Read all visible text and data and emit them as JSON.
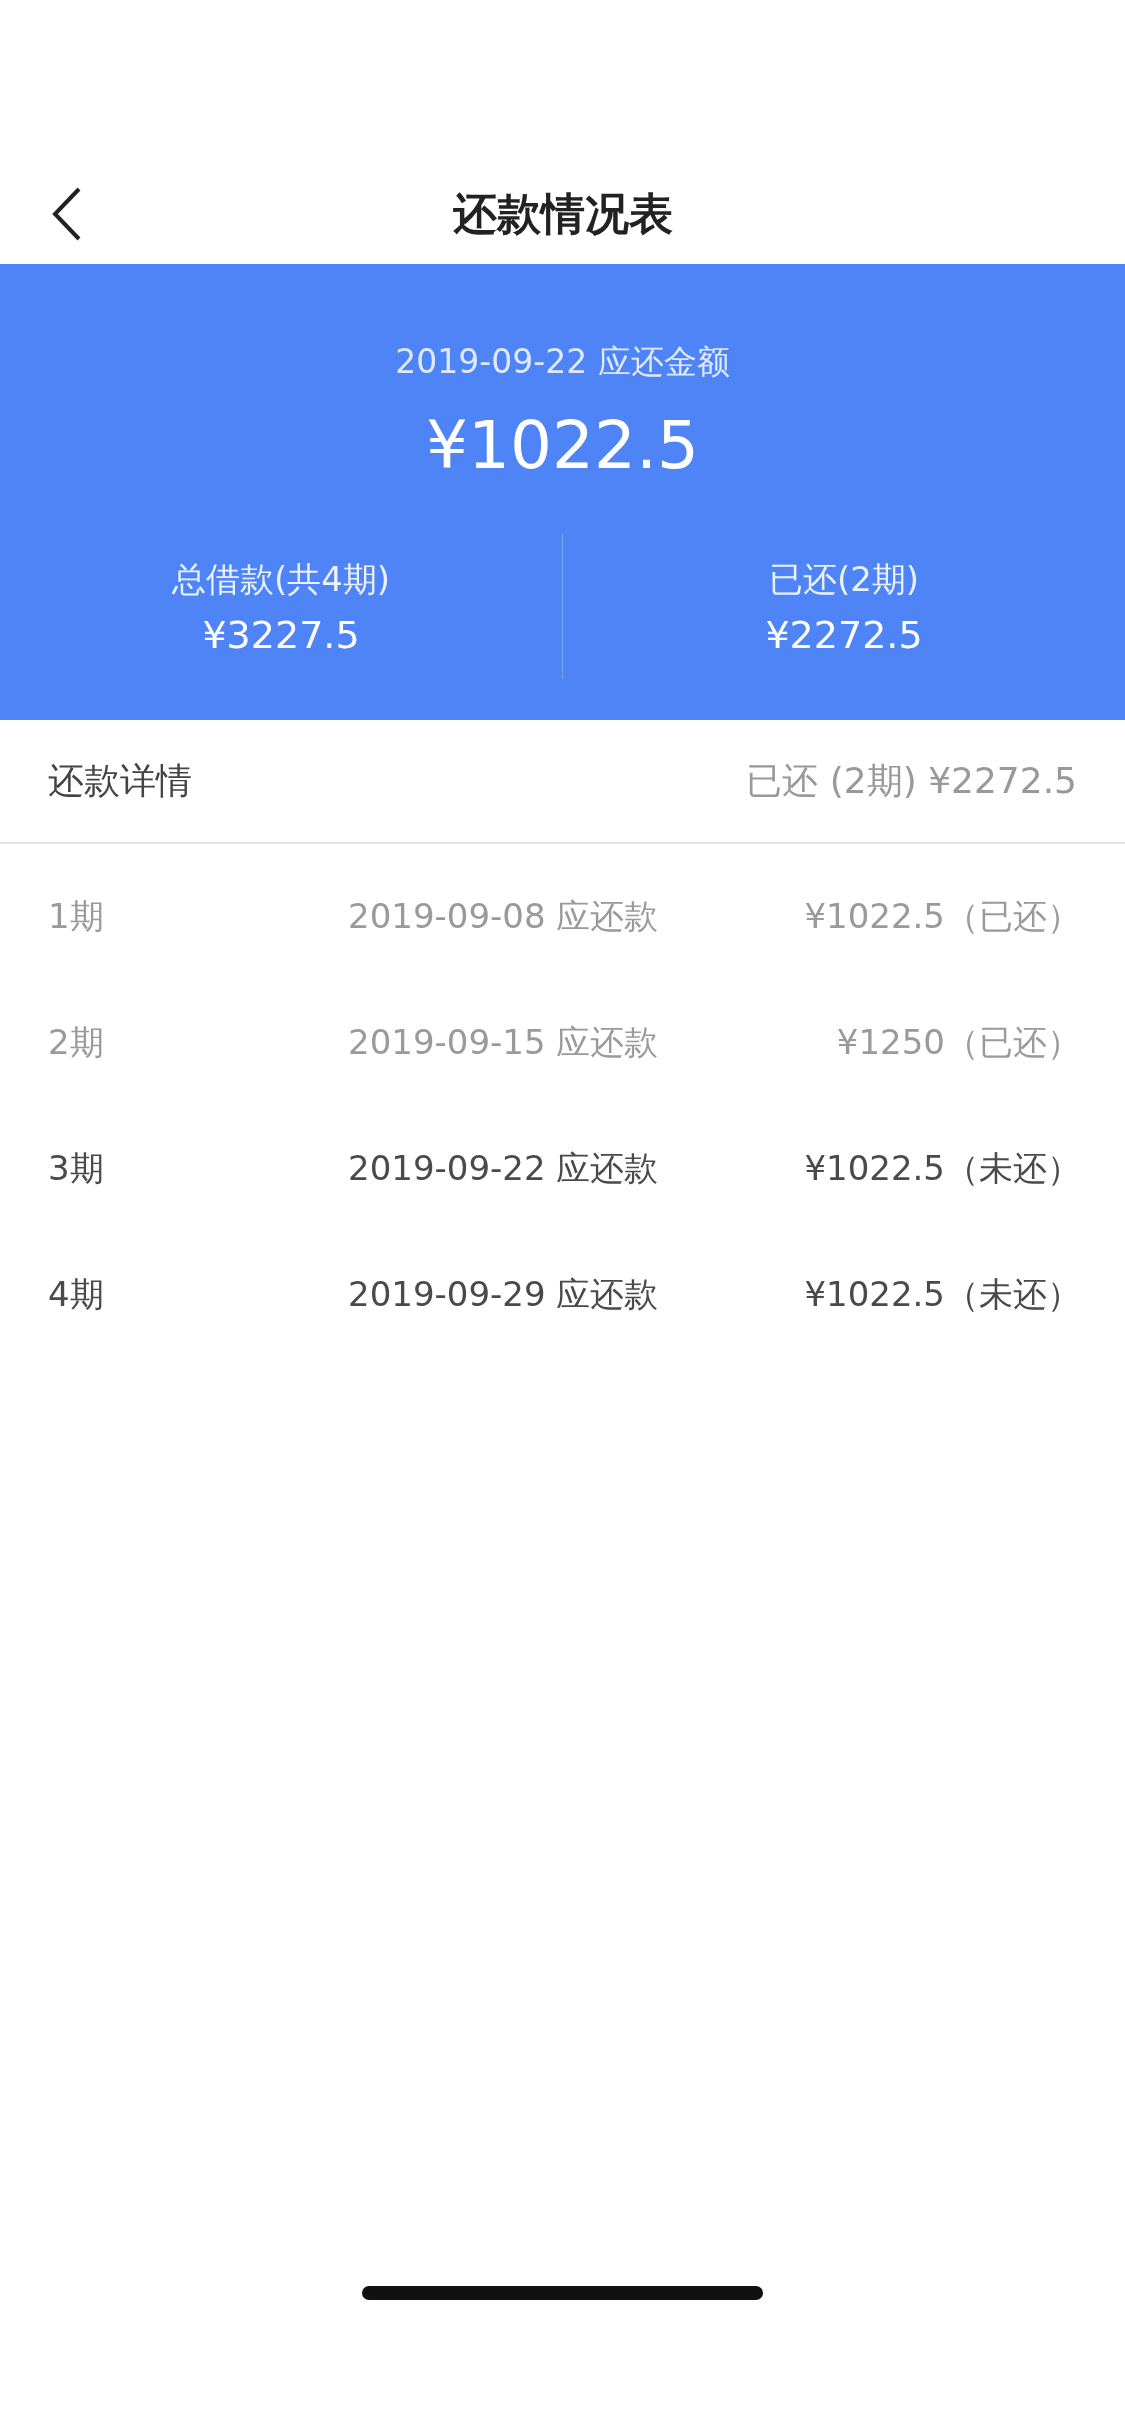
{
  "nav": {
    "title": "还款情况表"
  },
  "summary": {
    "due_label": "2019-09-22 应还金额",
    "due_amount": "¥1022.5",
    "stats": [
      {
        "label": "总借款(共4期)",
        "value": "¥3227.5"
      },
      {
        "label": "已还(2期)",
        "value": "¥2272.5"
      }
    ]
  },
  "details": {
    "title": "还款详情",
    "total": "已还 (2期) ¥2272.5"
  },
  "rows": [
    {
      "period": "1期",
      "date": "2019-09-08 应还款",
      "amount": "¥1022.5（已还）",
      "paid": true
    },
    {
      "period": "2期",
      "date": "2019-09-15 应还款",
      "amount": "¥1250（已还）",
      "paid": true
    },
    {
      "period": "3期",
      "date": "2019-09-22 应还款",
      "amount": "¥1022.5（未还）",
      "paid": false
    },
    {
      "period": "4期",
      "date": "2019-09-29 应还款",
      "amount": "¥1022.5（未还）",
      "paid": false
    }
  ]
}
